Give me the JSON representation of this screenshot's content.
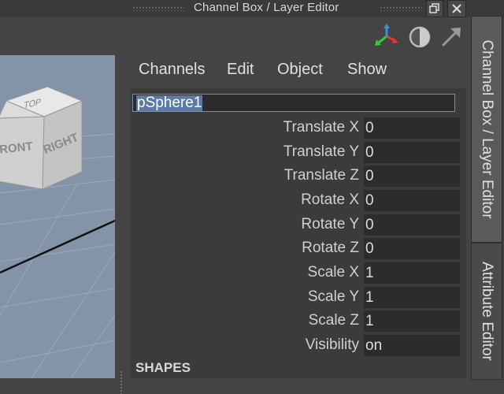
{
  "window": {
    "title": "Channel Box / Layer Editor",
    "restore_icon": "restore-icon",
    "close_icon": "close-icon"
  },
  "toolbar_icons": [
    "axis-manipulator-icon",
    "display-mode-icon",
    "arrow-icon"
  ],
  "menu": {
    "channels": "Channels",
    "edit": "Edit",
    "object": "Object",
    "show": "Show"
  },
  "viewcube": {
    "top": "TOP",
    "front": "FRONT",
    "right": "RIGHT"
  },
  "channel_box": {
    "node_name": "pSphere1",
    "channels": [
      {
        "label": "Translate X",
        "value": "0"
      },
      {
        "label": "Translate Y",
        "value": "0"
      },
      {
        "label": "Translate Z",
        "value": "0"
      },
      {
        "label": "Rotate X",
        "value": "0"
      },
      {
        "label": "Rotate Y",
        "value": "0"
      },
      {
        "label": "Rotate Z",
        "value": "0"
      },
      {
        "label": "Scale X",
        "value": "1"
      },
      {
        "label": "Scale Y",
        "value": "1"
      },
      {
        "label": "Scale Z",
        "value": "1"
      },
      {
        "label": "Visibility",
        "value": "on"
      }
    ],
    "shapes_header": "SHAPES"
  },
  "side_tabs": {
    "channel_box_tab": "Channel Box / Layer Editor",
    "attribute_editor_tab": "Attribute Editor"
  },
  "colors": {
    "panel_bg": "#444444",
    "field_bg": "#2c2c2c",
    "selection": "#5a7aa3",
    "viewport_bg": "#8494a8"
  }
}
